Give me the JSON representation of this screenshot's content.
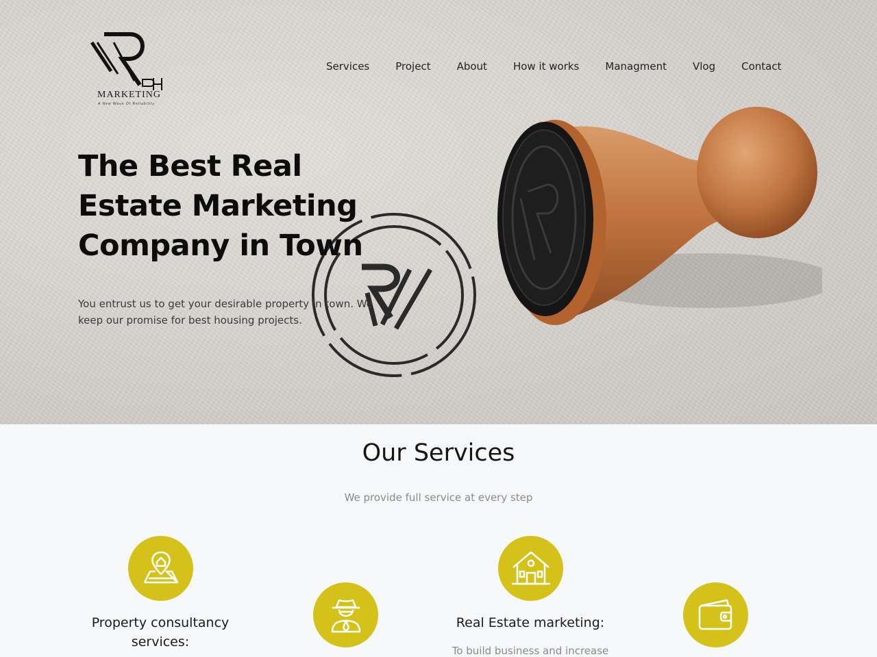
{
  "brand": {
    "name": "MARKETING",
    "monogram": "RH",
    "tagline": "A New Wave Of Reliability"
  },
  "nav": {
    "items": [
      {
        "label": "Services"
      },
      {
        "label": "Project"
      },
      {
        "label": "About"
      },
      {
        "label": "How it works"
      },
      {
        "label": "Managment"
      },
      {
        "label": "Vlog"
      },
      {
        "label": "Contact"
      }
    ]
  },
  "hero": {
    "title": "The Best Real Estate Marketing Company in Town",
    "description": "You entrust us to get your desirable property in town. We keep our promise for best housing projects."
  },
  "services": {
    "heading": "Our Services",
    "subheading": "We provide full service at every step",
    "accent_color": "#d4c21a",
    "items": [
      {
        "icon": "location-map-icon",
        "title": "Property consultancy services:",
        "description": ""
      },
      {
        "icon": "agent-detective-icon",
        "title": "",
        "description": ""
      },
      {
        "icon": "house-icon",
        "title": "Real Estate marketing:",
        "description": "To build business and increase"
      },
      {
        "icon": "wallet-icon",
        "title": "",
        "description": ""
      }
    ]
  }
}
